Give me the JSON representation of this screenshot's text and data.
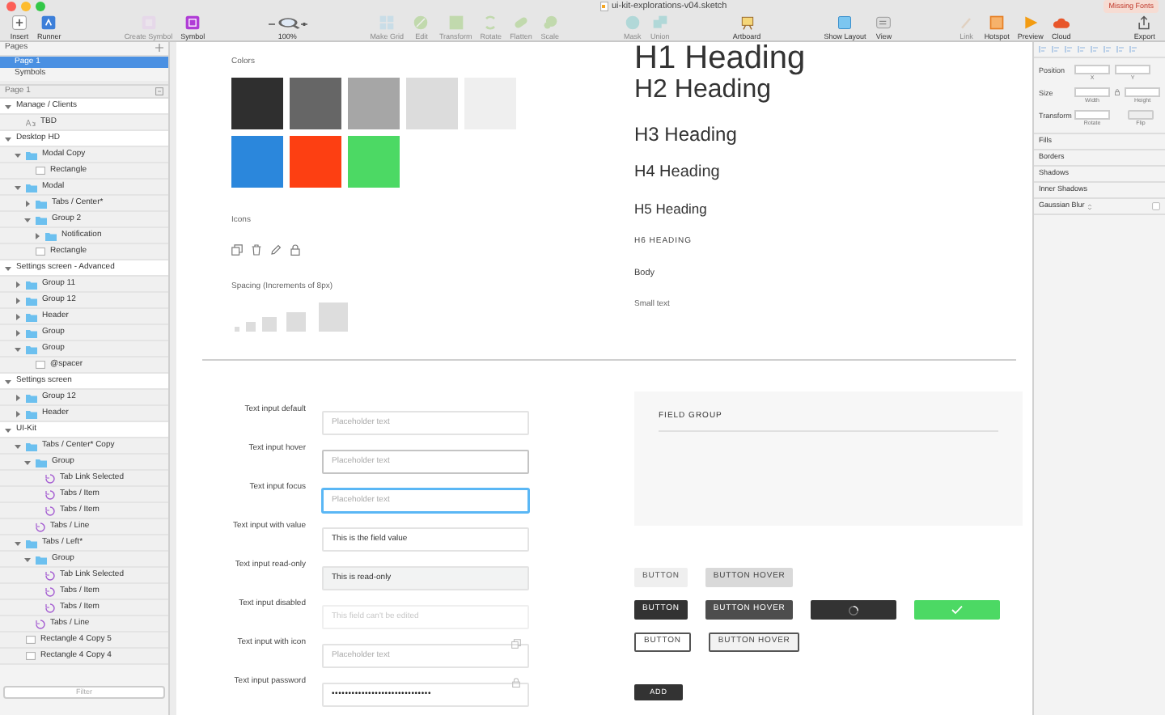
{
  "window": {
    "title": "ui-kit-explorations-v04.sketch",
    "badge": "Missing Fonts"
  },
  "toolbar": {
    "groups": [
      [
        {
          "label": "Insert",
          "disabled": false
        },
        {
          "label": "Runner",
          "disabled": false
        }
      ],
      [
        {
          "label": "Create Symbol",
          "disabled": true
        },
        {
          "label": "Symbol",
          "disabled": false
        }
      ],
      [
        {
          "label": "100%",
          "disabled": false
        }
      ],
      [
        {
          "label": "Make Grid",
          "disabled": true
        },
        {
          "label": "Edit",
          "disabled": true
        },
        {
          "label": "Transform",
          "disabled": true
        },
        {
          "label": "Rotate",
          "disabled": true
        },
        {
          "label": "Flatten",
          "disabled": true
        },
        {
          "label": "Scale",
          "disabled": true
        }
      ],
      [
        {
          "label": "Mask",
          "disabled": true
        },
        {
          "label": "Union",
          "disabled": true
        }
      ],
      [
        {
          "label": "Artboard",
          "disabled": false
        }
      ],
      [
        {
          "label": "Show Layout",
          "disabled": false
        },
        {
          "label": "View",
          "disabled": false
        }
      ],
      [
        {
          "label": "Link",
          "disabled": true
        },
        {
          "label": "Hotspot",
          "disabled": false
        },
        {
          "label": "Preview",
          "disabled": false
        },
        {
          "label": "Cloud",
          "disabled": false
        }
      ],
      [
        {
          "label": "Export",
          "disabled": false
        }
      ]
    ]
  },
  "sidebar": {
    "pages_title": "Pages",
    "pages": [
      {
        "label": "Page 1",
        "selected": true
      },
      {
        "label": "Symbols",
        "selected": false
      }
    ],
    "layers_title": "Page 1",
    "layers": [
      {
        "label": "Manage / Clients",
        "kind": "artboard",
        "expanded": true,
        "children": [
          {
            "label": "TBD",
            "kind": "text"
          }
        ]
      },
      {
        "label": "Desktop HD",
        "kind": "artboard",
        "expanded": true,
        "children": [
          {
            "label": "Modal Copy",
            "kind": "group",
            "expanded": true,
            "children": [
              {
                "label": "Rectangle",
                "kind": "shape"
              }
            ]
          },
          {
            "label": "Modal",
            "kind": "group",
            "expanded": true,
            "children": [
              {
                "label": "Tabs / Center*",
                "kind": "group",
                "expanded": false
              },
              {
                "label": "Group 2",
                "kind": "group",
                "expanded": true,
                "children": [
                  {
                    "label": "Notification",
                    "kind": "group",
                    "expanded": false
                  }
                ]
              },
              {
                "label": "Rectangle",
                "kind": "shape"
              }
            ]
          }
        ]
      },
      {
        "label": "Settings screen - Advanced",
        "kind": "artboard",
        "expanded": true,
        "children": [
          {
            "label": "Group 11",
            "kind": "group",
            "expanded": false
          },
          {
            "label": "Group 12",
            "kind": "group",
            "expanded": false
          },
          {
            "label": "Header",
            "kind": "group",
            "expanded": false
          },
          {
            "label": "Group",
            "kind": "group",
            "expanded": false
          },
          {
            "label": "Group",
            "kind": "group",
            "expanded": true,
            "children": [
              {
                "label": "@spacer",
                "kind": "shape"
              }
            ]
          }
        ]
      },
      {
        "label": "Settings screen",
        "kind": "artboard",
        "expanded": true,
        "children": [
          {
            "label": "Group 12",
            "kind": "group",
            "expanded": false
          },
          {
            "label": "Header",
            "kind": "group",
            "expanded": false
          }
        ]
      },
      {
        "label": "UI-Kit",
        "kind": "artboard",
        "expanded": true,
        "children": [
          {
            "label": "Tabs / Center* Copy",
            "kind": "group",
            "expanded": true,
            "children": [
              {
                "label": "Group",
                "kind": "group",
                "expanded": true,
                "children": [
                  {
                    "label": "Tab Link Selected",
                    "kind": "symbol"
                  },
                  {
                    "label": "Tabs / Item",
                    "kind": "symbol"
                  },
                  {
                    "label": "Tabs / Item",
                    "kind": "symbol"
                  }
                ]
              },
              {
                "label": "Tabs / Line",
                "kind": "symbol"
              }
            ]
          },
          {
            "label": "Tabs / Left*",
            "kind": "group",
            "expanded": true,
            "children": [
              {
                "label": "Group",
                "kind": "group",
                "expanded": true,
                "children": [
                  {
                    "label": "Tab Link Selected",
                    "kind": "symbol"
                  },
                  {
                    "label": "Tabs / Item",
                    "kind": "symbol"
                  },
                  {
                    "label": "Tabs / Item",
                    "kind": "symbol"
                  }
                ]
              },
              {
                "label": "Tabs / Line",
                "kind": "symbol"
              }
            ]
          },
          {
            "label": "Rectangle 4 Copy 5",
            "kind": "shape"
          },
          {
            "label": "Rectangle 4 Copy 4",
            "kind": "shape"
          }
        ]
      }
    ],
    "filter": {
      "placeholder": "Filter"
    }
  },
  "canvas": {
    "colors_title": "Colors",
    "swatches": [
      {
        "color": "#2f2f2f"
      },
      {
        "color": "#666666"
      },
      {
        "color": "#a6a6a6"
      },
      {
        "color": "#dcdcdc"
      },
      {
        "color": "#efefef"
      },
      {
        "color": "#2b87dc"
      },
      {
        "color": "#fd3f12"
      },
      {
        "color": "#4cd964"
      }
    ],
    "icons_title": "Icons",
    "spacing_title": "Spacing (Increments of 8px)",
    "headings": [
      {
        "kind": "h1",
        "text": "H1 Heading"
      },
      {
        "kind": "h2",
        "text": "H2 Heading"
      },
      {
        "kind": "h3",
        "text": "H3 Heading"
      },
      {
        "kind": "h4",
        "text": "H4 Heading"
      },
      {
        "kind": "h5",
        "text": "H5 Heading"
      },
      {
        "kind": "h6",
        "text": "H6 HEADING"
      },
      {
        "kind": "body",
        "text": "Body"
      },
      {
        "kind": "small",
        "text": "Small text"
      }
    ],
    "inputs": [
      {
        "label": "Text input default",
        "kind": "default",
        "placeholder": "Placeholder text"
      },
      {
        "label": "Text input hover",
        "kind": "hover",
        "placeholder": "Placeholder text"
      },
      {
        "label": "Text input focus",
        "kind": "focus",
        "placeholder": "Placeholder text"
      },
      {
        "label": "Text input with value",
        "kind": "default",
        "value": "This is the field value"
      },
      {
        "label": "Text input read-only",
        "kind": "readonly",
        "value": "This is read-only"
      },
      {
        "label": "Text input disabled",
        "kind": "disabled",
        "placeholder": "This field can't be edited"
      },
      {
        "label": "Text input with icon",
        "kind": "icon",
        "placeholder": "Placeholder text"
      },
      {
        "label": "Text input password",
        "kind": "password",
        "value": "••••••••••••••••••••••••••••••"
      }
    ],
    "field_group": {
      "title": "FIELD GROUP"
    },
    "button_rows": [
      [
        {
          "kind": "light",
          "hover": false,
          "label": "BUTTON"
        },
        {
          "kind": "light",
          "hover": true,
          "label": "BUTTON HOVER"
        }
      ],
      [
        {
          "kind": "dark",
          "hover": false,
          "label": "BUTTON"
        },
        {
          "kind": "dark",
          "hover": true,
          "label": "BUTTON HOVER"
        },
        {
          "kind": "spinner",
          "hover": false
        },
        {
          "kind": "check",
          "hover": false
        }
      ],
      [
        {
          "kind": "outline",
          "hover": false,
          "label": "BUTTON"
        },
        {
          "kind": "outline",
          "hover": true,
          "label": "BUTTON HOVER"
        }
      ]
    ],
    "add_button": {
      "label": "ADD"
    }
  },
  "inspector": {
    "rows": [
      {
        "kind": "pair",
        "label": "Position",
        "fields": [
          {
            "caption": "X"
          },
          {
            "caption": "Y"
          }
        ]
      },
      {
        "kind": "size",
        "label": "Size",
        "fields": [
          {
            "caption": "Width"
          },
          {
            "caption": "Height"
          }
        ]
      },
      {
        "kind": "transform",
        "label": "Transform",
        "fields": [
          {
            "caption": "Rotate"
          },
          {
            "caption": "Flip"
          }
        ]
      }
    ],
    "sections": [
      {
        "kind": "plain",
        "label": "Fills"
      },
      {
        "kind": "plain",
        "label": "Borders"
      },
      {
        "kind": "plain",
        "label": "Shadows"
      },
      {
        "kind": "plain",
        "label": "Inner Shadows"
      },
      {
        "kind": "blur",
        "label": "Gaussian Blur",
        "checked": false
      }
    ]
  }
}
